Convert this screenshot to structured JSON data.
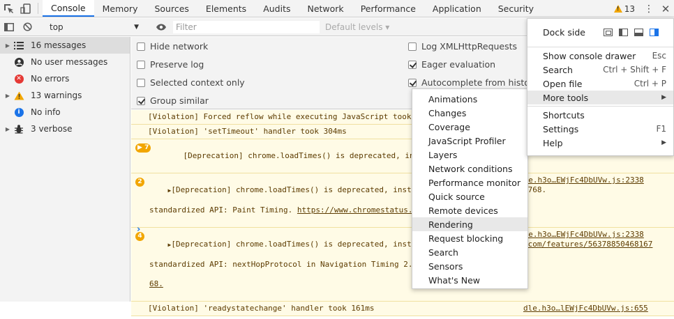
{
  "tabs": [
    {
      "label": "Console",
      "active": true
    },
    {
      "label": "Memory"
    },
    {
      "label": "Sources"
    },
    {
      "label": "Elements"
    },
    {
      "label": "Audits"
    },
    {
      "label": "Network"
    },
    {
      "label": "Performance"
    },
    {
      "label": "Application"
    },
    {
      "label": "Security"
    }
  ],
  "warning_count": "13",
  "toolbar": {
    "context": "top",
    "filter_placeholder": "Filter",
    "levels": "Default levels"
  },
  "sidebar": [
    {
      "label": "16 messages",
      "icon": "list-icon"
    },
    {
      "label": "No user messages",
      "icon": "user-icon"
    },
    {
      "label": "No errors",
      "icon": "error-icon"
    },
    {
      "label": "13 warnings",
      "icon": "warning-icon"
    },
    {
      "label": "No info",
      "icon": "info-icon"
    },
    {
      "label": "3 verbose",
      "icon": "bug-icon"
    }
  ],
  "settings": {
    "hide_network": "Hide network",
    "preserve_log": "Preserve log",
    "selected_context": "Selected context only",
    "group_similar": "Group similar",
    "log_xhr": "Log XMLHttpRequests",
    "eager_eval": "Eager evaluation",
    "autocomplete": "Autocomplete from history"
  },
  "messages": [
    {
      "text": "[Violation] Forced reflow while executing JavaScript took"
    },
    {
      "text": "[Violation] 'setTimeout' handler took 304ms"
    },
    {
      "badge": "7",
      "text": "[Deprecation] chrome.loadTimes() is deprecated, instead"
    },
    {
      "badge": "2",
      "line1": "[Deprecation] chrome.loadTimes() is deprecated, instead",
      "src1": "dle.h3o…EWjFc4DbUVw.js:2338",
      "line2": "standardized API: Paint Timing. ",
      "link2": "https://www.chromestatus.",
      "tail2": "6768."
    },
    {
      "badge": "4",
      "line1": "[Deprecation] chrome.loadTimes() is deprecated, instead",
      "src1": "dle.h3o…EWjFc4DbUVw.js:2338",
      "line2": "standardized API: nextHopProtocol in Navigation Timing 2.",
      "tail2": ".com/features/56378850468167",
      "line3": "68."
    },
    {
      "text": "[Violation] 'readystatechange' handler took 161ms",
      "src1": "dle.h3o…lEWjFc4DbUVw.js:655"
    }
  ],
  "more_tools": [
    "Animations",
    "Changes",
    "Coverage",
    "JavaScript Profiler",
    "Layers",
    "Network conditions",
    "Performance monitor",
    "Quick source",
    "Remote devices",
    "Rendering",
    "Request blocking",
    "Search",
    "Sensors",
    "What's New"
  ],
  "more_tools_highlighted": "Rendering",
  "main_menu": {
    "dock_side": "Dock side",
    "items": [
      {
        "label": "Show console drawer",
        "shortcut": "Esc"
      },
      {
        "label": "Search",
        "shortcut": "Ctrl + Shift + F"
      },
      {
        "label": "Open file",
        "shortcut": "Ctrl + P"
      },
      {
        "label": "More tools",
        "shortcut": "▶"
      },
      {
        "label": "Shortcuts",
        "shortcut": ""
      },
      {
        "label": "Settings",
        "shortcut": "F1"
      },
      {
        "label": "Help",
        "shortcut": "▶"
      }
    ]
  },
  "colors": {
    "accent": "#1a73e8",
    "warning": "#f2a600",
    "warn_bg": "#fffbe6",
    "error": "#e53935"
  }
}
